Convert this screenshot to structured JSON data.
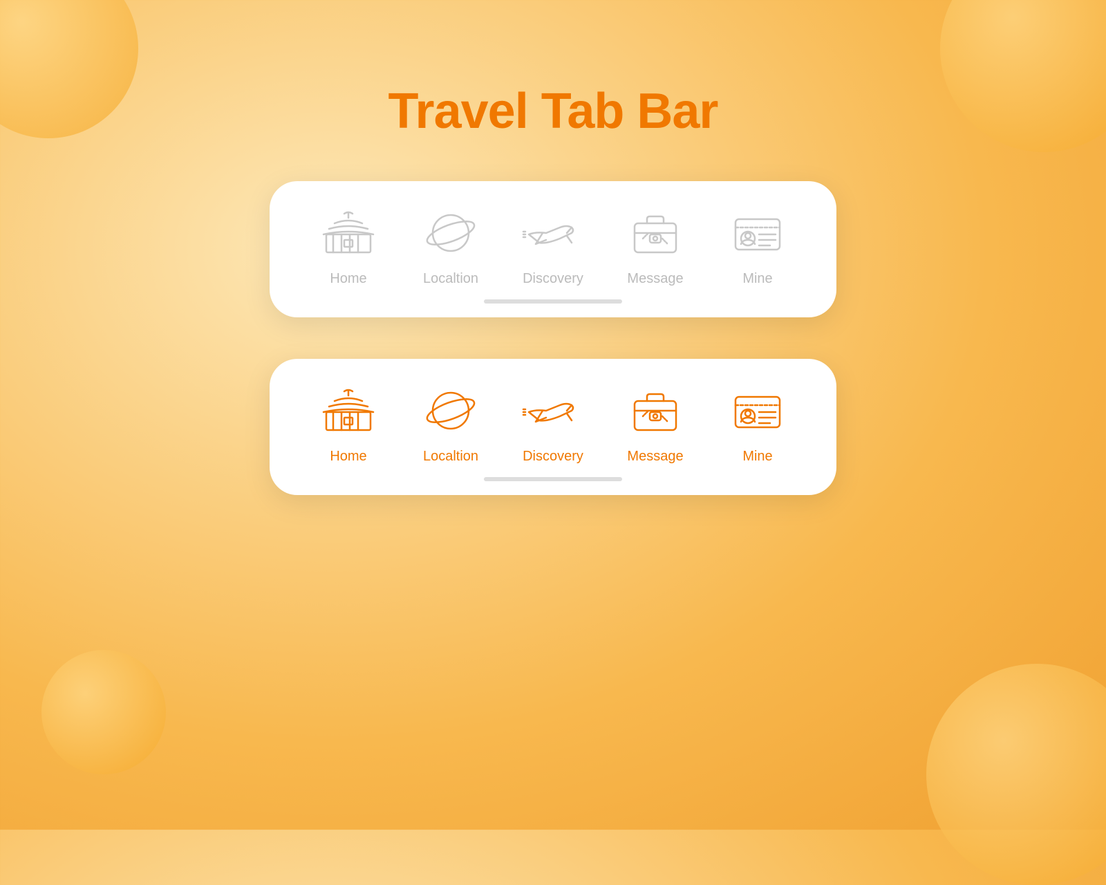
{
  "page": {
    "title": "Travel Tab Bar",
    "title_color": "#f07800"
  },
  "tab_bar_inactive": {
    "items": [
      {
        "id": "home",
        "label": "Home"
      },
      {
        "id": "location",
        "label": "Localtion"
      },
      {
        "id": "discovery",
        "label": "Discovery"
      },
      {
        "id": "message",
        "label": "Message"
      },
      {
        "id": "mine",
        "label": "Mine"
      }
    ]
  },
  "tab_bar_active": {
    "items": [
      {
        "id": "home",
        "label": "Home"
      },
      {
        "id": "location",
        "label": "Localtion"
      },
      {
        "id": "discovery",
        "label": "Discovery"
      },
      {
        "id": "message",
        "label": "Message"
      },
      {
        "id": "mine",
        "label": "Mine"
      }
    ]
  }
}
